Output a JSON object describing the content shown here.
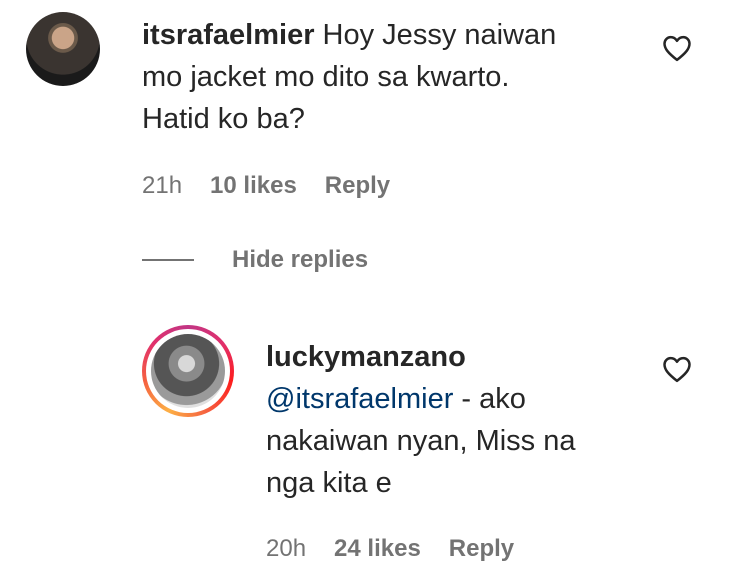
{
  "comment1": {
    "username": "itsrafaelmier",
    "text_line1": " Hoy Jessy naiwan",
    "text_line2": "mo jacket mo dito sa kwarto.",
    "text_line3": "Hatid ko ba?",
    "time": "21h",
    "likes": "10 likes",
    "reply_label": "Reply"
  },
  "hide_replies_label": "Hide replies",
  "reply1": {
    "username": "luckymanzano",
    "mention": "@itsrafaelmier",
    "text_line1": " - ako",
    "text_line2": "nakaiwan nyan, Miss na",
    "text_line3": "nga kita e",
    "time": "20h",
    "likes": "24 likes",
    "reply_label": "Reply"
  },
  "icons": {
    "like": "heart-outline-icon"
  },
  "colors": {
    "text": "#262626",
    "secondary": "#737373",
    "mention": "#00376b",
    "story_ring": "#e1306c"
  }
}
